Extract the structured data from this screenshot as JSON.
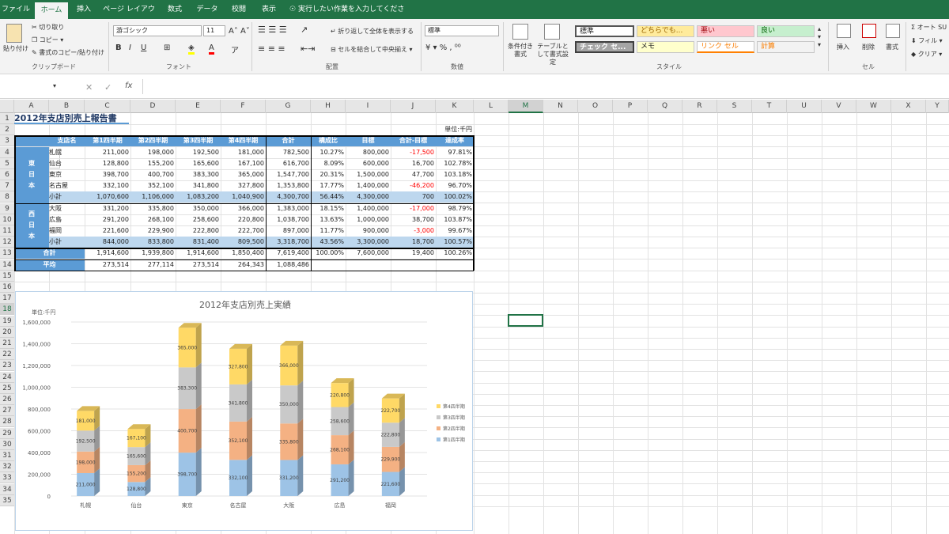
{
  "tabs": [
    "ファイル",
    "ホーム",
    "挿入",
    "ページ レイアウト",
    "数式",
    "データ",
    "校閲",
    "表示"
  ],
  "tell_me": "実行したい作業を入力してください...",
  "ribbon": {
    "paste": "貼り付け",
    "cut": "切り取り",
    "copy": "コピー",
    "format_painter": "書式のコピー/貼り付け",
    "clipboard_group": "クリップボード",
    "font_name": "游ゴシック",
    "font_size": "11",
    "font_group": "フォント",
    "wrap": "折り返して全体を表示する",
    "merge": "セルを結合して中央揃え",
    "align_group": "配置",
    "num_format": "標準",
    "num_group": "数値",
    "cond_fmt": "条件付き書式",
    "table_fmt": "テーブルとして書式設定",
    "style_group": "スタイル",
    "styles": [
      "標準",
      "どちらでも...",
      "悪い",
      "良い",
      "チェック セ...",
      "メモ",
      "リンク セル",
      "計算"
    ],
    "insert": "挿入",
    "delete": "削除",
    "format": "書式",
    "cell_group": "セル",
    "autosum": "オート SU",
    "fill": "フィル",
    "clear": "クリア"
  },
  "namebox": "M18",
  "columns": [
    "A",
    "B",
    "C",
    "D",
    "E",
    "F",
    "G",
    "H",
    "I",
    "J",
    "K",
    "L",
    "M",
    "N",
    "O",
    "P",
    "Q",
    "R",
    "S",
    "T",
    "U",
    "V",
    "W",
    "X",
    "Y"
  ],
  "sheet": {
    "title": "2012年支店別売上報告書",
    "unit": "単位:千円",
    "headers": [
      "支店名",
      "第1四半期",
      "第2四半期",
      "第3四半期",
      "第4四半期",
      "合計",
      "構成比",
      "目標",
      "合計-目標",
      "達成率"
    ],
    "east_label": [
      "東",
      "日",
      "本"
    ],
    "west_label": [
      "西",
      "日",
      "本"
    ],
    "east": [
      [
        "札幌",
        "211,000",
        "198,000",
        "192,500",
        "181,000",
        "782,500",
        "10.27%",
        "800,000",
        "-17,500",
        "97.81%"
      ],
      [
        "仙台",
        "128,800",
        "155,200",
        "165,600",
        "167,100",
        "616,700",
        "8.09%",
        "600,000",
        "16,700",
        "102.78%"
      ],
      [
        "東京",
        "398,700",
        "400,700",
        "383,300",
        "365,000",
        "1,547,700",
        "20.31%",
        "1,500,000",
        "47,700",
        "103.18%"
      ],
      [
        "名古屋",
        "332,100",
        "352,100",
        "341,800",
        "327,800",
        "1,353,800",
        "17.77%",
        "1,400,000",
        "-46,200",
        "96.70%"
      ],
      [
        "小計",
        "1,070,600",
        "1,106,000",
        "1,083,200",
        "1,040,900",
        "4,300,700",
        "56.44%",
        "4,300,000",
        "700",
        "100.02%"
      ]
    ],
    "west": [
      [
        "大阪",
        "331,200",
        "335,800",
        "350,000",
        "366,000",
        "1,383,000",
        "18.15%",
        "1,400,000",
        "-17,000",
        "98.79%"
      ],
      [
        "広島",
        "291,200",
        "268,100",
        "258,600",
        "220,800",
        "1,038,700",
        "13.63%",
        "1,000,000",
        "38,700",
        "103.87%"
      ],
      [
        "福岡",
        "221,600",
        "229,900",
        "222,800",
        "222,700",
        "897,000",
        "11.77%",
        "900,000",
        "-3,000",
        "99.67%"
      ],
      [
        "小計",
        "844,000",
        "833,800",
        "831,400",
        "809,500",
        "3,318,700",
        "43.56%",
        "3,300,000",
        "18,700",
        "100.57%"
      ]
    ],
    "total": [
      "合計",
      "1,914,600",
      "1,939,800",
      "1,914,600",
      "1,850,400",
      "7,619,400",
      "100.00%",
      "7,600,000",
      "19,400",
      "100.26%"
    ],
    "average": [
      "平均",
      "273,514",
      "277,114",
      "273,514",
      "264,343",
      "1,088,486"
    ]
  },
  "chart_data": {
    "type": "bar",
    "stacked": true,
    "title": "2012年支店別売上実績",
    "unit_label": "単位:千円",
    "categories": [
      "札幌",
      "仙台",
      "東京",
      "名古屋",
      "大阪",
      "広島",
      "福岡"
    ],
    "series": [
      {
        "name": "第1四半期",
        "color": "#9dc3e6",
        "values": [
          211000,
          128800,
          398700,
          332100,
          331200,
          291200,
          221600
        ]
      },
      {
        "name": "第2四半期",
        "color": "#f4b183",
        "values": [
          198000,
          155200,
          400700,
          352100,
          335800,
          268100,
          229900
        ]
      },
      {
        "name": "第3四半期",
        "color": "#c9c9c9",
        "values": [
          192500,
          165600,
          383300,
          341800,
          350000,
          258600,
          222800
        ]
      },
      {
        "name": "第4四半期",
        "color": "#ffd966",
        "values": [
          181000,
          167100,
          365000,
          327800,
          366000,
          220800,
          222700
        ]
      }
    ],
    "data_labels": [
      [
        "211,000",
        "128,800",
        "398,700",
        "332,100",
        "331,200",
        "291,200",
        "221,600"
      ],
      [
        "198,000",
        "155,200",
        "400,700",
        "352,100",
        "335,800",
        "268,100",
        "229,900"
      ],
      [
        "192,500",
        "165,600",
        "383,300",
        "341,800",
        "350,000",
        "258,600",
        "222,800"
      ],
      [
        "181,000",
        "167,100",
        "365,000",
        "327,800",
        "366,000",
        "220,800",
        "222,700"
      ]
    ],
    "ylim": [
      0,
      1600000
    ],
    "yticks": [
      "0",
      "200,000",
      "400,000",
      "600,000",
      "800,000",
      "1,000,000",
      "1,200,000",
      "1,400,000",
      "1,600,000"
    ],
    "legend_position": "right",
    "legend": [
      "第4四半期",
      "第3四半期",
      "第2四半期",
      "第1四半期"
    ]
  }
}
